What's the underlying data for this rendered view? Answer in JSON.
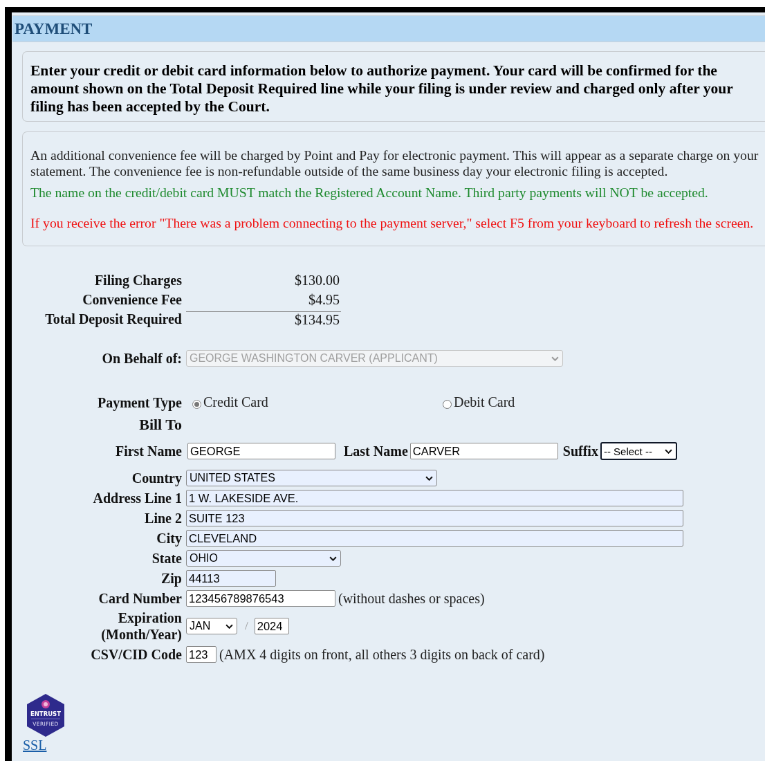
{
  "header": {
    "title": "PAYMENT"
  },
  "notice": "Enter your credit or debit card information below to authorize payment. Your card will be confirmed for the amount shown on the Total Deposit Required line while your filing is under review and charged only after your filing has been accepted by the Court.",
  "info": [
    {
      "kind": "plain",
      "text": "An additional convenience fee will be charged by Point and Pay for electronic payment. This will appear as a separate charge on your statement. The convenience fee is non-refundable outside of the same business day your electronic filing is accepted."
    },
    {
      "kind": "success",
      "text": "The name on the credit/debit card MUST match the Registered Account Name. Third party payments will NOT be accepted."
    },
    {
      "kind": "error",
      "text": "If you receive the error \"There was a problem connecting to the payment server,\" select F5 from your keyboard to refresh the screen."
    }
  ],
  "charges": [
    {
      "kind": "item",
      "label": "Filing Charges",
      "amount": "$130.00"
    },
    {
      "kind": "item",
      "label": "Convenience Fee",
      "amount": "$4.95"
    },
    {
      "kind": "total",
      "label": "Total Deposit Required",
      "amount": "$134.95"
    }
  ],
  "on_behalf": {
    "label": "On Behalf of:",
    "value": "GEORGE WASHINGTON CARVER (APPLICANT)",
    "disabled": true
  },
  "payment_type": {
    "label": "Payment Type",
    "options": [
      {
        "label": "Credit Card",
        "selected": true
      },
      {
        "label": "Debit Card",
        "selected": false
      }
    ]
  },
  "bill_to": {
    "title": "Bill To",
    "first_name": {
      "label": "First Name",
      "value": "GEORGE",
      "autofilled": false
    },
    "last_name": {
      "label": "Last Name",
      "value": "CARVER",
      "autofilled": false
    },
    "suffix": {
      "label": "Suffix",
      "value": "-- Select --",
      "focused": true
    },
    "country": {
      "label": "Country",
      "value": "UNITED STATES",
      "autofilled": true
    },
    "address_1": {
      "label": "Address Line 1",
      "value": "1 W. LAKESIDE AVE.",
      "autofilled": true
    },
    "address_2": {
      "label": "Line 2",
      "value": "SUITE 123",
      "autofilled": true
    },
    "city": {
      "label": "City",
      "value": "CLEVELAND",
      "autofilled": true
    },
    "state": {
      "label": "State",
      "value": "OHIO",
      "autofilled": true
    },
    "zip": {
      "label": "Zip",
      "value": "44113",
      "autofilled": true
    },
    "card_number": {
      "label": "Card Number",
      "value": "123456789876543",
      "autofilled": false,
      "hint": "(without dashes or spaces)"
    },
    "expiration": {
      "label_lines": [
        "Expiration",
        "(Month/Year)"
      ],
      "month": {
        "value": "JAN",
        "autofilled": false
      },
      "separator": "/",
      "year": {
        "value": "2024",
        "autofilled": false
      }
    },
    "csv": {
      "label": "CSV/CID Code",
      "value": "123",
      "autofilled": false,
      "hint": "(AMX 4 digits on front, all others 3 digits on back of card)"
    }
  },
  "seal": {
    "brand": "ENTRUST",
    "caption": "VERIFIED"
  },
  "ssl_link": "SSL"
}
